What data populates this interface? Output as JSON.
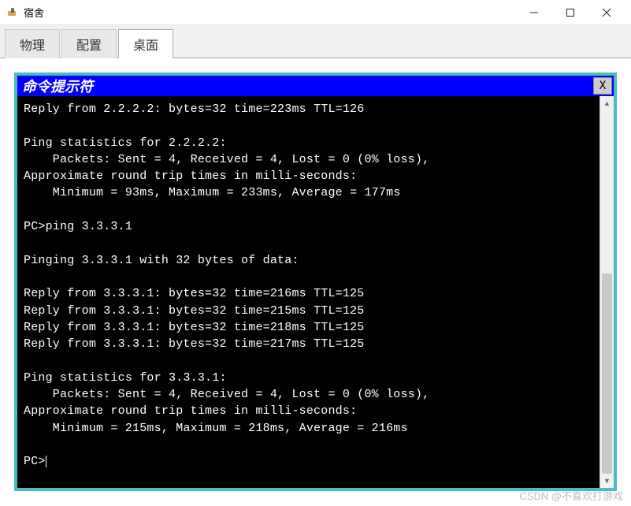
{
  "window": {
    "title": "宿舍"
  },
  "tabs": {
    "t0": "物理",
    "t1": "配置",
    "t2": "桌面"
  },
  "terminal": {
    "title": "命令提示符",
    "close_label": "X",
    "lines": [
      "Reply from 2.2.2.2: bytes=32 time=223ms TTL=126",
      "",
      "Ping statistics for 2.2.2.2:",
      "    Packets: Sent = 4, Received = 4, Lost = 0 (0% loss),",
      "Approximate round trip times in milli-seconds:",
      "    Minimum = 93ms, Maximum = 233ms, Average = 177ms",
      "",
      "PC>ping 3.3.3.1",
      "",
      "Pinging 3.3.3.1 with 32 bytes of data:",
      "",
      "Reply from 3.3.3.1: bytes=32 time=216ms TTL=125",
      "Reply from 3.3.3.1: bytes=32 time=215ms TTL=125",
      "Reply from 3.3.3.1: bytes=32 time=218ms TTL=125",
      "Reply from 3.3.3.1: bytes=32 time=217ms TTL=125",
      "",
      "Ping statistics for 3.3.3.1:",
      "    Packets: Sent = 4, Received = 4, Lost = 0 (0% loss),",
      "Approximate round trip times in milli-seconds:",
      "    Minimum = 215ms, Maximum = 218ms, Average = 216ms",
      ""
    ],
    "prompt": "PC>"
  },
  "watermark": "CSDN @不喜欢打游戏"
}
